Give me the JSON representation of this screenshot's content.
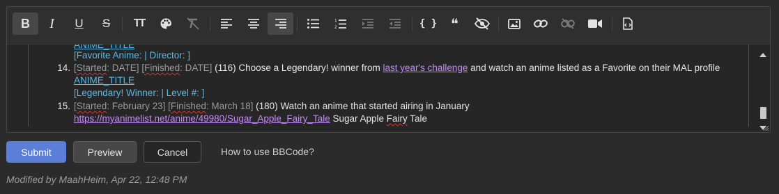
{
  "toolbar": {
    "items": [
      "bold",
      "italic",
      "underline",
      "strikethrough",
      "font-size",
      "color",
      "remove-format",
      "align-left",
      "align-center",
      "align-right",
      "bullet-list",
      "numbered-list",
      "indent",
      "outdent",
      "code",
      "quote",
      "spoiler",
      "image",
      "link",
      "unlink",
      "video",
      "source"
    ],
    "icons": {
      "bold": "B",
      "italic": "I",
      "underline": "U",
      "strike": "S",
      "text_size": "TT",
      "code": "{ }",
      "quote": "❝"
    }
  },
  "editor": {
    "top_partial": "ANIME_TITLE",
    "favorite_line": "[Favorite Anime:  | Director: ]",
    "item14": {
      "number": "14.",
      "started_label": "Started",
      "started_value": ": DATE]",
      "finished_label": "Finished",
      "finished_value": ": DATE]",
      "body_pre": " (116) Choose a Legendary! winner from ",
      "link_text": "last year's challenge",
      "body_post": " and watch an anime listed as a Favorite on their MAL profile",
      "title": "ANIME_TITLE",
      "meta": "[Legendary! Winner:  | Level #:  ]"
    },
    "item15": {
      "number": "15.",
      "started_label": "Started",
      "started_value": ": February 23]",
      "finished_label": "Finished",
      "finished_value": ": March 18]",
      "body": " (180) Watch an anime that started airing in January",
      "url": "https://myanimelist.net/anime/49980/Sugar_Apple_Fairy_Tale",
      "title_pre": " Sugar Apple ",
      "title_fairy": "Fairy",
      "title_post": " Tale"
    }
  },
  "actions": {
    "submit": "Submit",
    "preview": "Preview",
    "cancel": "Cancel",
    "help": "How to use BBCode?"
  },
  "footer": {
    "modified": "Modified by MaahHeim, Apr 22, 12:48 PM"
  },
  "colors": {
    "background": "#2b2b2b",
    "accent": "#5b7fd8",
    "link": "#c58af9",
    "bbcode_tag": "#58b9e6"
  }
}
